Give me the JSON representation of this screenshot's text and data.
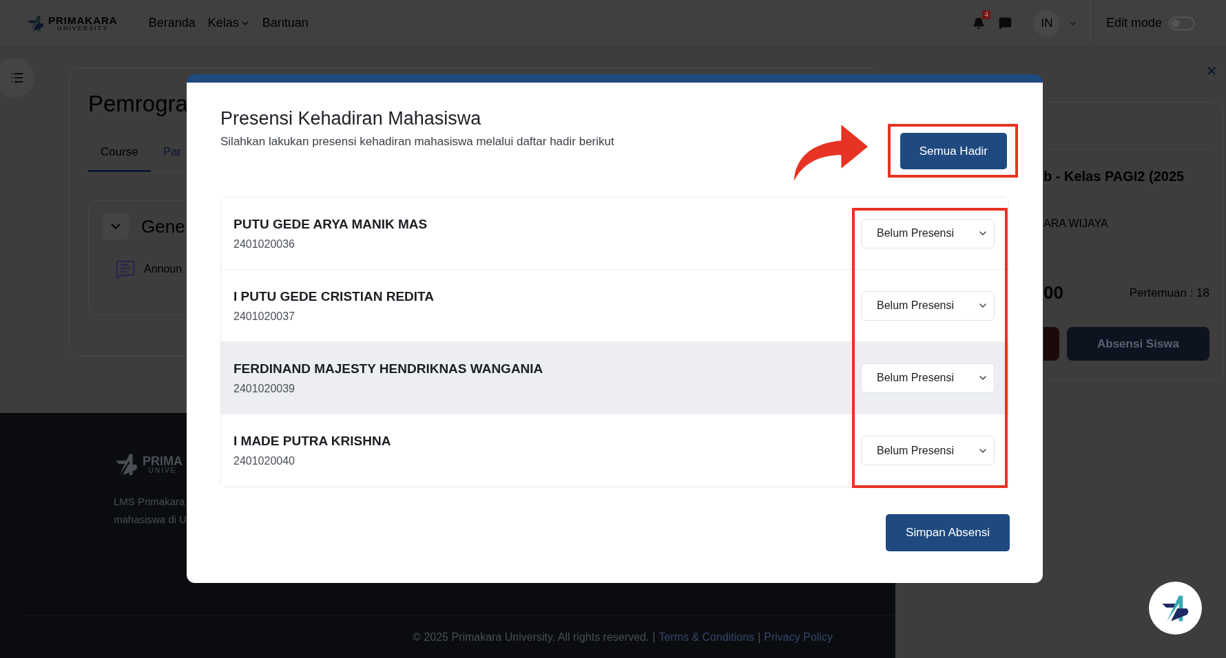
{
  "navbar": {
    "brand": {
      "name": "PRIMAKARA",
      "tagline": "UNIVERSITY"
    },
    "links": [
      {
        "label": "Beranda",
        "dropdown": false
      },
      {
        "label": "Kelas",
        "dropdown": true
      },
      {
        "label": "Bantuan",
        "dropdown": false
      }
    ],
    "notification_count": "4",
    "language": "IN",
    "edit_mode": {
      "label": "Edit mode",
      "on": false
    }
  },
  "course": {
    "title": "Pemrogra",
    "tabs": [
      {
        "label": "Course",
        "selected": true
      },
      {
        "label": "Par",
        "selected": false
      }
    ],
    "section": {
      "title": "Gene",
      "expanded": true,
      "items": [
        {
          "label": "Announ"
        }
      ]
    }
  },
  "footer": {
    "brand": {
      "name": "PRIMA",
      "tagline": "UNIVE"
    },
    "description": [
      "LMS Primakara",
      "mahasiswa di U"
    ],
    "copyright": "© 2025 Primakara University. All rights reserved.",
    "separator": "|",
    "links": [
      "Terms & Conditions",
      "Privacy Policy"
    ]
  },
  "drawer": {
    "class_title": "b - Kelas PAGI2 (2025",
    "lecturer": "ARA WIJAYA",
    "time": "00",
    "meeting": "Pertemuan : 18",
    "attendance_button": "Absensi Siswa"
  },
  "modal": {
    "title": "Presensi Kehadiran Mahasiswa",
    "subtitle": "Silahkan lakukan presensi kehadiran mahasiswa melalui daftar hadir berikut",
    "mark_all_button": "Semua Hadir",
    "students": [
      {
        "name": "PUTU GEDE ARYA MANIK MAS",
        "nim": "2401020036",
        "status": "Belum Presensi",
        "highlighted": false
      },
      {
        "name": "I PUTU GEDE CRISTIAN REDITA",
        "nim": "2401020037",
        "status": "Belum Presensi",
        "highlighted": false
      },
      {
        "name": "FERDINAND MAJESTY HENDRIKNAS WANGANIA",
        "nim": "2401020039",
        "status": "Belum Presensi",
        "highlighted": true
      },
      {
        "name": "I MADE PUTRA KRISHNA",
        "nim": "2401020040",
        "status": "Belum Presensi",
        "highlighted": false
      }
    ],
    "save_button": "Simpan Absensi"
  },
  "annotations": {
    "arrow": true,
    "button_frame": true,
    "status_frame": true
  }
}
